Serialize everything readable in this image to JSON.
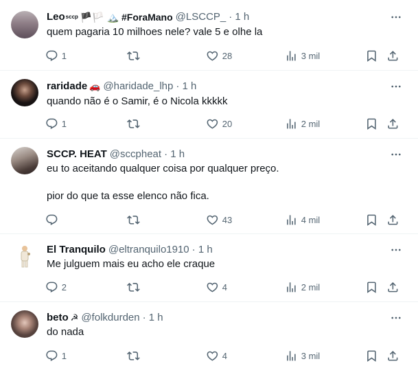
{
  "colors": {
    "text": "#0f1419",
    "muted": "#536471",
    "divider": "#eff3f4"
  },
  "tweets": [
    {
      "name": "Leo",
      "name_suffix": "sccp",
      "name_extra": "🏴🏳️ 🏔️ #ForaMano",
      "handle": "@LSCCP_",
      "time": "· 1 h",
      "text": "quem pagaria 10 milhoes nele? vale 5 e olhe la",
      "replies": "1",
      "retweets": "",
      "likes": "28",
      "views": "3 mil"
    },
    {
      "name": "raridade",
      "name_extra": "🚗",
      "handle": "@haridade_lhp",
      "time": "· 1 h",
      "text": "quando não é o Samir, é o Nicola kkkkk",
      "replies": "1",
      "retweets": "",
      "likes": "20",
      "views": "2 mil"
    },
    {
      "name": "SCCP. HEAT",
      "name_extra": "",
      "handle": "@sccpheat",
      "time": "· 1 h",
      "text": "eu to aceitando qualquer coisa por qualquer preço.\n\npior do que ta esse elenco não fica.",
      "replies": "",
      "retweets": "",
      "likes": "43",
      "views": "4 mil"
    },
    {
      "name": "El Tranquilo",
      "name_extra": "",
      "handle": "@eltranquilo1910",
      "time": "· 1 h",
      "text": "Me julguem mais eu acho ele craque",
      "replies": "2",
      "retweets": "",
      "likes": "4",
      "views": "2 mil"
    },
    {
      "name": "beto",
      "name_extra": "☭",
      "handle": "@folkdurden",
      "time": "· 1 h",
      "text": "do nada",
      "replies": "1",
      "retweets": "",
      "likes": "4",
      "views": "3 mil"
    }
  ]
}
